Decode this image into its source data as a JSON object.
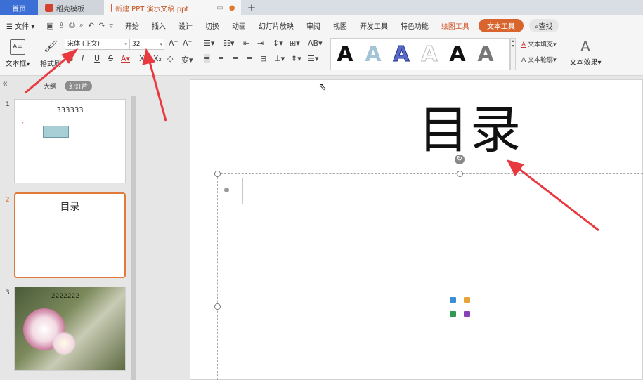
{
  "tabs": [
    {
      "label": "首页"
    },
    {
      "label": "稻壳模板"
    },
    {
      "label": "新建 PPT 演示文稿.ppt"
    }
  ],
  "menubar": {
    "file": "文件",
    "items": [
      "开始",
      "插入",
      "设计",
      "切换",
      "动画",
      "幻灯片放映",
      "审阅",
      "视图",
      "开发工具",
      "特色功能"
    ],
    "drawing_tools": "绘图工具",
    "text_tools": "文本工具",
    "search": "查找"
  },
  "ribbon": {
    "textbox_label": "文本框",
    "format_painter_label": "格式刷",
    "font_name": "宋体 (正文)",
    "font_size": "32",
    "text_fill": "文本填充",
    "text_outline": "文本轮廓",
    "text_effect": "文本效果",
    "art_styles": [
      "A",
      "A",
      "A",
      "A",
      "A",
      "A"
    ]
  },
  "panel": {
    "outline_tab": "大纲",
    "slides_tab": "幻灯片",
    "slides": [
      {
        "num": "1",
        "title": "333333"
      },
      {
        "num": "2",
        "title": "目录"
      },
      {
        "num": "3",
        "title": "2222222"
      }
    ]
  },
  "slide": {
    "title": "目录"
  },
  "colors": {
    "accent": "#d8642e",
    "home_tab": "#3b6fd6",
    "arrow": "#e8393f"
  }
}
